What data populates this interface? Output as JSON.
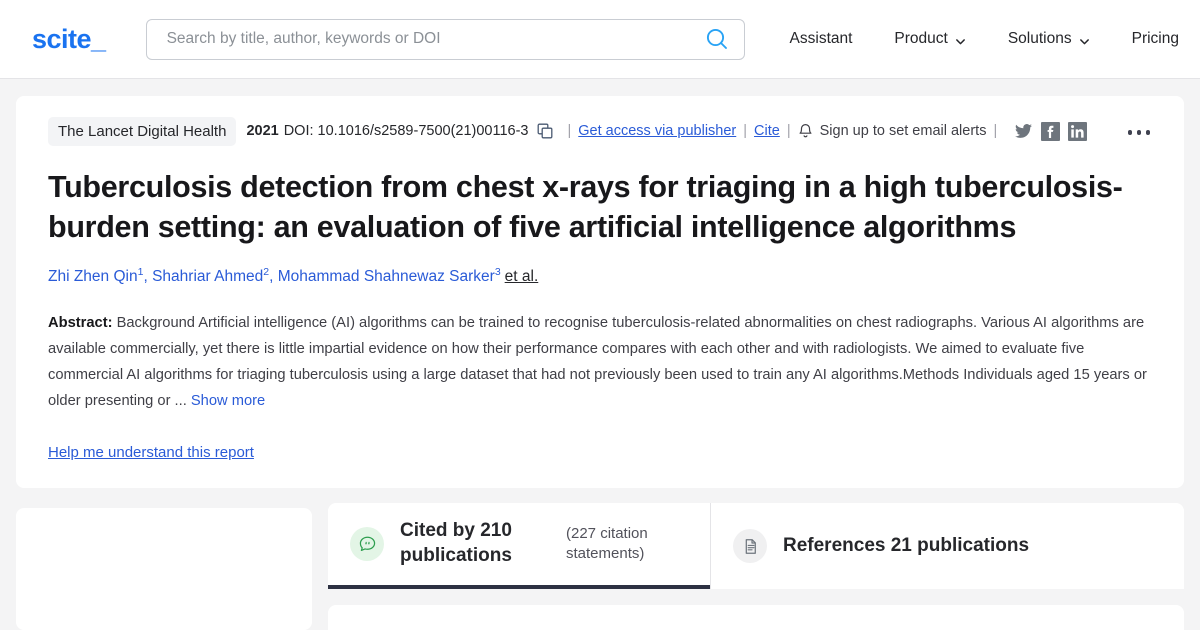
{
  "header": {
    "logo": "scite_",
    "search": {
      "placeholder": "Search by title, author, keywords or DOI",
      "value": ""
    },
    "search_icon": "search-icon",
    "nav": [
      {
        "label": "Assistant",
        "has_chevron": false
      },
      {
        "label": "Product",
        "has_chevron": true
      },
      {
        "label": "Solutions",
        "has_chevron": true
      },
      {
        "label": "Pricing",
        "has_chevron": false
      }
    ]
  },
  "paper": {
    "journal": "The Lancet Digital Health",
    "year": "2021",
    "doi": "DOI: 10.1016/s2589-7500(21)00116-3",
    "copy_icon": "copy-icon",
    "access_link": "Get access via publisher",
    "cite_link": "Cite",
    "bell_icon": "bell-icon",
    "alerts_text": "Sign up to set email alerts",
    "separator": "|",
    "socials": [
      {
        "name": "twitter-icon"
      },
      {
        "name": "facebook-icon"
      },
      {
        "name": "linkedin-icon"
      }
    ],
    "more_icon": "more-options-icon",
    "title": "Tuberculosis detection from chest x-rays for triaging in a high tuberculosis-burden setting: an evaluation of five artificial intelligence algorithms",
    "authors": [
      {
        "name": "Zhi Zhen Qin",
        "sup": "1"
      },
      {
        "name": "Shahriar Ahmed",
        "sup": "2"
      },
      {
        "name": "Mohammad Shahnewaz Sarker",
        "sup": "3"
      }
    ],
    "et_al": "et al.",
    "abstract_label": "Abstract:",
    "abstract_text": "Background Artificial intelligence (AI) algorithms can be trained to recognise tuberculosis-related abnormalities on chest radiographs. Various AI algorithms are available commercially, yet there is little impartial evidence on how their performance compares with each other and with radiologists. We aimed to evaluate five commercial AI algorithms for triaging tuberculosis using a large dataset that had not previously been used to train any AI algorithms.Methods Individuals aged 15 years or older presenting or ...",
    "show_more": "Show more",
    "help_link": "Help me understand this report"
  },
  "tabs": [
    {
      "icon": "citation-bubble-icon",
      "label": "Cited by 210 publications",
      "sub": "(227 citation statements)",
      "active": true
    },
    {
      "icon": "document-icon",
      "label": "References 21 publications",
      "sub": "",
      "active": false
    }
  ],
  "colors": {
    "brand_blue": "#1a73f0",
    "link_blue": "#2a5bd7",
    "search_icon": "#29a3f5",
    "active_tab_border": "#2d3142",
    "citation_green": "#2e9e4f",
    "page_bg": "#f4f4f5"
  }
}
